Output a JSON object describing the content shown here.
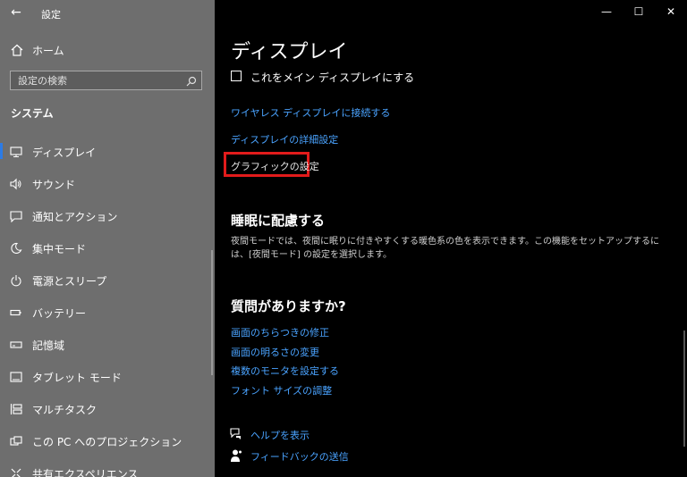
{
  "app": {
    "title": "設定"
  },
  "sidebar": {
    "home_label": "ホーム",
    "search_placeholder": "設定の検索",
    "section_title": "システム",
    "items": [
      {
        "label": "ディスプレイ",
        "icon": "monitor-icon"
      },
      {
        "label": "サウンド",
        "icon": "speaker-icon"
      },
      {
        "label": "通知とアクション",
        "icon": "notification-icon"
      },
      {
        "label": "集中モード",
        "icon": "moon-icon"
      },
      {
        "label": "電源とスリープ",
        "icon": "power-icon"
      },
      {
        "label": "バッテリー",
        "icon": "battery-icon"
      },
      {
        "label": "記憶域",
        "icon": "storage-icon"
      },
      {
        "label": "タブレット モード",
        "icon": "tablet-icon"
      },
      {
        "label": "マルチタスク",
        "icon": "multitask-icon"
      },
      {
        "label": "この PC へのプロジェクション",
        "icon": "projection-icon"
      },
      {
        "label": "共有エクスペリエンス",
        "icon": "share-icon"
      }
    ],
    "selected_index": 0
  },
  "main": {
    "title": "ディスプレイ",
    "checkbox_label": "これをメイン ディスプレイにする",
    "links": {
      "wireless": "ワイヤレス ディスプレイに接続する",
      "advanced": "ディスプレイの詳細設定",
      "graphics": "グラフィックの設定"
    },
    "sleep": {
      "title": "睡眠に配慮する",
      "description": "夜間モードでは、夜間に眠りに付きやすくする暖色系の色を表示できます。この機能をセットアップするには、[夜間モード] の設定を選択します。"
    },
    "questions": {
      "title": "質問がありますか?",
      "links": [
        "画面のちらつきの修正",
        "画面の明るさの変更",
        "複数のモニタを設定する",
        "フォント サイズの調整"
      ]
    },
    "help": {
      "get_help": "ヘルプを表示",
      "feedback": "フィードバックの送信"
    }
  },
  "window_controls": {
    "minimize": "—",
    "maximize": "☐",
    "close": "✕"
  },
  "colors": {
    "sidebar_bg": "#6e6e6e",
    "main_bg": "#000000",
    "link": "#4aa3ff",
    "highlight": "#e21b1b",
    "accent": "#2c7be5"
  }
}
